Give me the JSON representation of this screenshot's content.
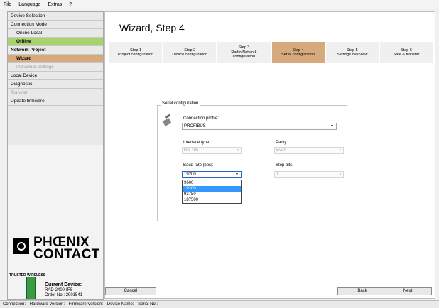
{
  "menu": [
    "File",
    "Language",
    "Extras",
    "?"
  ],
  "sidebar": {
    "items": [
      {
        "label": "Device Selection"
      },
      {
        "label": "Connection Mode"
      },
      {
        "label": "Online Local"
      },
      {
        "label": "Offline"
      },
      {
        "label": "Network Project"
      },
      {
        "label": "Wizard"
      },
      {
        "label": "Individual Settings"
      },
      {
        "label": "Local Device"
      },
      {
        "label": "Diagnostic"
      },
      {
        "label": "Transfer"
      },
      {
        "label": "Update firmware"
      }
    ],
    "logo_text": "PHŒNIX CONTACT",
    "logo_line1": "PHŒNIX",
    "logo_line2": "CONTACT",
    "trusted_text": "TRUSTED WIRELESS",
    "current_device_label": "Current Device:",
    "current_device_model": "RAD-2400-IFS",
    "current_device_order": "Order No.: 2901541"
  },
  "main": {
    "title": "Wizard, Step 4",
    "steps": [
      {
        "n": "Step 1",
        "label": "Project configuration"
      },
      {
        "n": "Step 2",
        "label": "Device configuration"
      },
      {
        "n": "Step 3",
        "label": "Radio Network configuration"
      },
      {
        "n": "Step 4",
        "label": "Serial configuration"
      },
      {
        "n": "Step 5",
        "label": "Settings overview"
      },
      {
        "n": "Step 6",
        "label": "Safe & transfer"
      }
    ],
    "serial": {
      "legend": "Serial configuration",
      "conn_profile_label": "Connection profile:",
      "conn_profile_value": "PROFIBUS",
      "interface_label": "Interface type:",
      "interface_value": "RS-485",
      "parity_label": "Parity:",
      "parity_value": "Even",
      "baud_label": "Baud rate [bps]:",
      "baud_value": "19200",
      "stop_label": "Stop bits:",
      "stop_value": "1",
      "baud_options": [
        "9600",
        "19200",
        "93750",
        "187500"
      ]
    },
    "buttons": {
      "cancel": "Cancel",
      "back": "Back",
      "next": "Next"
    }
  },
  "statusbar": {
    "connection": "Connection:",
    "hardware": "Hardware Version:",
    "firmware": "Firmware Version:",
    "device_name": "Device Name:",
    "serial_no": "Serial No.:"
  },
  "colors": {
    "active_step": "#d6aa7c",
    "offline": "#a8d26b",
    "selection": "#3399ff"
  }
}
